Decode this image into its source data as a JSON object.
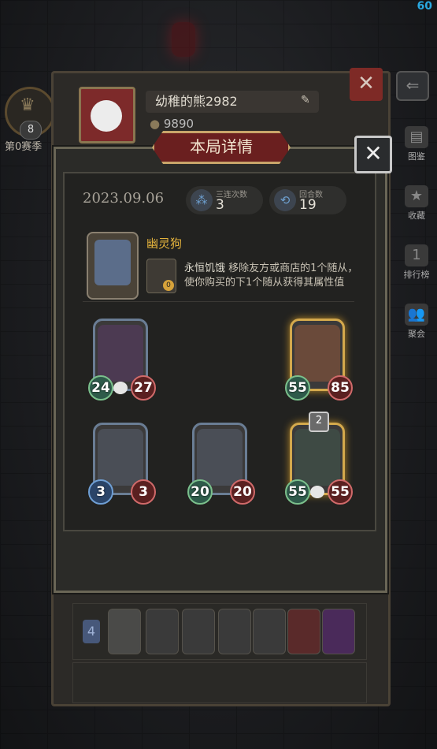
{
  "hud": {
    "fps": "60"
  },
  "season": {
    "number": "8",
    "label": "第0赛季"
  },
  "profile": {
    "nickname": "幼稚的熊2982",
    "coins": "9890"
  },
  "side_nav": [
    {
      "label": "图鉴",
      "icon": "book-icon"
    },
    {
      "label": "收藏",
      "icon": "star-icon"
    },
    {
      "label": "排行榜",
      "icon": "rank-icon"
    },
    {
      "label": "聚会",
      "icon": "party-icon"
    }
  ],
  "dialog": {
    "title": "本局详情",
    "date": "2023.09.06",
    "stats": [
      {
        "label": "三连次数",
        "value": "3",
        "icon": "triple-icon"
      },
      {
        "label": "回合数",
        "value": "19",
        "icon": "rounds-icon"
      }
    ],
    "hero": {
      "name": "幽灵狗",
      "power_level": "0",
      "ability_name": "永恒饥饿",
      "ability_text": "移除友方或商店的1个随从，使你购买的下1个随从获得其属性值"
    },
    "minions": [
      {
        "attack": "24",
        "health": "27",
        "gold": false,
        "tier": ""
      },
      {
        "attack": "55",
        "health": "85",
        "gold": true,
        "tier": ""
      },
      {
        "attack": "3",
        "health": "3",
        "gold": false,
        "tier": ""
      },
      {
        "attack": "20",
        "health": "20",
        "gold": false,
        "tier": ""
      },
      {
        "attack": "55",
        "health": "55",
        "gold": true,
        "tier": "2"
      }
    ]
  },
  "history": [
    {
      "rank": "4"
    },
    {
      "rank": ""
    }
  ],
  "colors": {
    "accent_gold": "#e3b23c",
    "title_red": "#6a1f1f"
  }
}
